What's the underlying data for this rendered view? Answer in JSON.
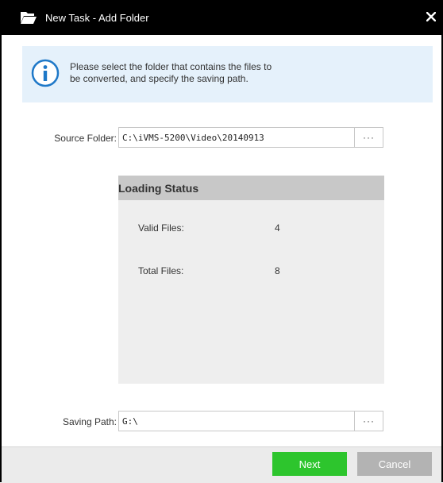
{
  "dialog": {
    "title": "New Task - Add Folder",
    "close_glyph": "✕"
  },
  "info": {
    "line1": "Please select the folder that contains the files to",
    "line2": "be converted, and specify the saving path."
  },
  "source_folder": {
    "label": "Source Folder:",
    "value": "C:\\iVMS-5200\\Video\\20140913",
    "browse_label": "···"
  },
  "loading_status": {
    "title": "Loading Status",
    "rows": [
      {
        "label": "Valid Files:",
        "value": "4"
      },
      {
        "label": "Total Files:",
        "value": "8"
      }
    ]
  },
  "saving_path": {
    "label": "Saving Path:",
    "value": "G:\\",
    "browse_label": "···"
  },
  "footer": {
    "next_label": "Next",
    "cancel_label": "Cancel"
  },
  "colors": {
    "titlebar": "#000000",
    "info_bg": "#e5f1fb",
    "info_icon": "#1e78c8",
    "next_button": "#2dc52d",
    "cancel_button": "#b3b3b3"
  },
  "icons": {
    "title": "folder-open-icon",
    "close": "close-icon",
    "info": "info-icon"
  }
}
